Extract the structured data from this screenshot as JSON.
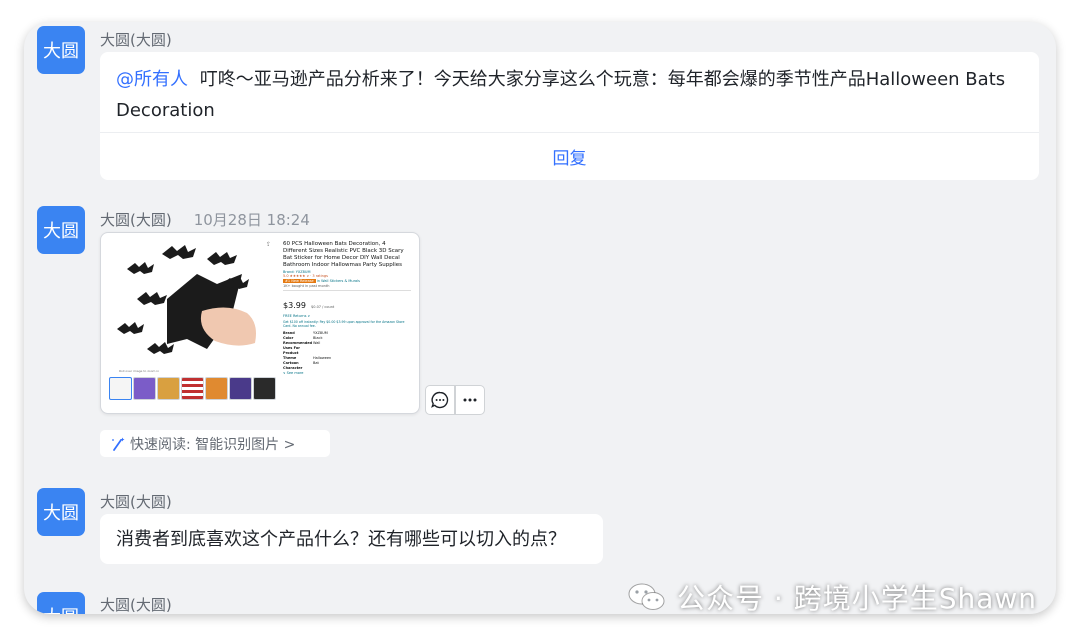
{
  "colors": {
    "avatar_bg": "#3a84f2",
    "mention": "#3370ff",
    "reply": "#3370ff",
    "background": "#f1f2f4"
  },
  "messages": [
    {
      "avatar_text": "大圆",
      "sender": "大圆(大圆)",
      "mention": "@所有人",
      "text": "叮咚～亚马逊产品分析来了！今天给大家分享这么个玩意：每年都会爆的季节性产品Halloween Bats Decoration",
      "reply_label": "回复"
    },
    {
      "avatar_text": "大圆",
      "sender": "大圆(大圆)",
      "time": "10月28日 18:24",
      "image": {
        "product_title": "60 PCS Halloween Bats Decoration, 4 Different Sizes Realistic PVC Black 3D Scary Bat Sticker for Home Decor DIY Wall Decal Bathroom Indoor Hallowmas Party Supplies",
        "store": "Brand: YXZ8UM",
        "rating_text": "5.0 ★★★★★ ∨  · 3 ratings",
        "badge": "#1 New Release",
        "badge_category": "in Wall Stickers & Murals",
        "bought": "1K+ bought in past month",
        "price": "$3.99",
        "price_note": "$0.07 / count",
        "returns": "FREE Returns ∨",
        "promo": "Get $100 off instantly: Pay $0.00 $3.99 upon approval for the Amazon Store Card. No annual fee.",
        "specs": [
          {
            "label": "Brand",
            "value": "YXZ8UM"
          },
          {
            "label": "Color",
            "value": "Black"
          },
          {
            "label": "Recommended Uses For Product",
            "value": "Wall"
          },
          {
            "label": "Theme",
            "value": "Halloween"
          },
          {
            "label": "Cartoon Character",
            "value": "Bat"
          }
        ],
        "see_more": "∨ See more",
        "rollover_caption": "Roll over image to zoom in"
      },
      "quick_read": "快速阅读: 智能识别图片 >",
      "actions": {
        "comment_icon": "comment-icon",
        "more_icon": "more-dots-icon"
      }
    },
    {
      "avatar_text": "大圆",
      "sender": "大圆(大圆)",
      "text": "消费者到底喜欢这个产品什么？还有哪些可以切入的点？"
    },
    {
      "avatar_text": "大圆",
      "sender": "大圆(大圆)"
    }
  ],
  "watermark": {
    "icon": "wechat-icon",
    "text": "公众号 · 跨境小学生Shawn"
  }
}
